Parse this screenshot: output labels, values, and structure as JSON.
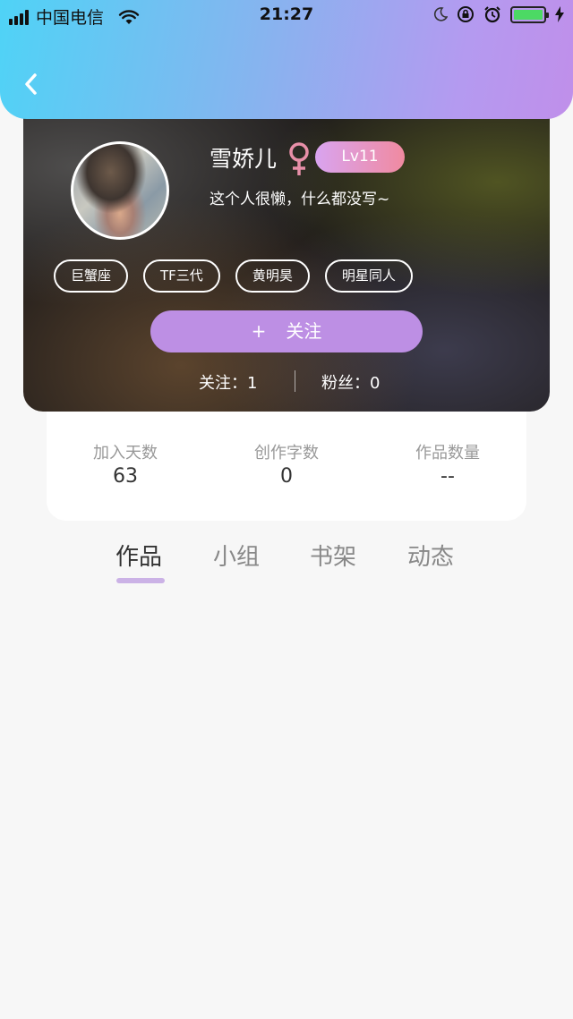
{
  "status_bar": {
    "carrier": "中国电信",
    "time": "21:27"
  },
  "profile": {
    "nickname": "雪娇儿",
    "gender_symbol": "♀",
    "level": "Lv11",
    "bio": "这个人很懒，什么都没写~",
    "tags": [
      "巨蟹座",
      "TF三代",
      "黄明昊",
      "明星同人"
    ],
    "follow_button": {
      "plus": "+",
      "label": "关注"
    },
    "following": "关注：1",
    "fans": "粉丝：0"
  },
  "stats": [
    {
      "label": "加入天数",
      "value": "63"
    },
    {
      "label": "创作字数",
      "value": "0"
    },
    {
      "label": "作品数量",
      "value": "--"
    }
  ],
  "tabs": [
    {
      "label": "作品",
      "active": true
    },
    {
      "label": "小组",
      "active": false
    },
    {
      "label": "书架",
      "active": false
    },
    {
      "label": "动态",
      "active": false
    }
  ],
  "colors": {
    "header_gradient_start": "#4fd3f6",
    "header_gradient_end": "#c08fea",
    "follow_button": "#bd8fe4",
    "tab_indicator": "#cbb2e6",
    "level_badge_start": "#d9a4f0",
    "level_badge_end": "#f08aa0",
    "gender_icon": "#e88fa8"
  }
}
